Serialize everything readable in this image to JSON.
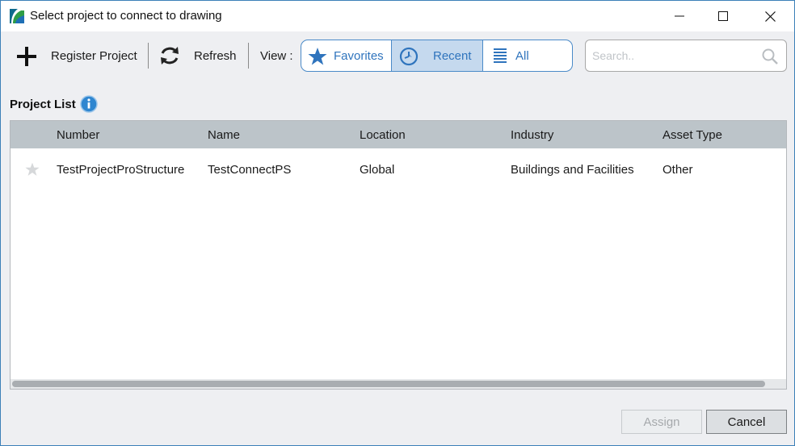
{
  "window": {
    "title": "Select project to connect to drawing",
    "icon": "app-logo-icon"
  },
  "toolbar": {
    "register_label": "Register Project",
    "refresh_label": "Refresh",
    "view_label": "View :",
    "view_options": [
      {
        "label": "Favorites",
        "icon": "star-icon",
        "selected": false
      },
      {
        "label": "Recent",
        "icon": "clock-icon",
        "selected": true
      },
      {
        "label": "All",
        "icon": "list-icon",
        "selected": false
      }
    ],
    "search_placeholder": "Search..",
    "search_value": ""
  },
  "project_list": {
    "title": "Project List",
    "columns": [
      "Number",
      "Name",
      "Location",
      "Industry",
      "Asset Type"
    ],
    "rows": [
      {
        "favorite": false,
        "number": "TestProjectProStructure",
        "name": "TestConnectPS",
        "location": "Global",
        "industry": "Buildings and Facilities",
        "asset_type": "Other"
      }
    ]
  },
  "footer": {
    "assign_label": "Assign",
    "assign_enabled": false,
    "cancel_label": "Cancel"
  },
  "colors": {
    "accent": "#2f74bd",
    "selected_view_bg": "#c5d9ee",
    "header_bg": "#bcc4c9",
    "window_border": "#3c80b8"
  }
}
